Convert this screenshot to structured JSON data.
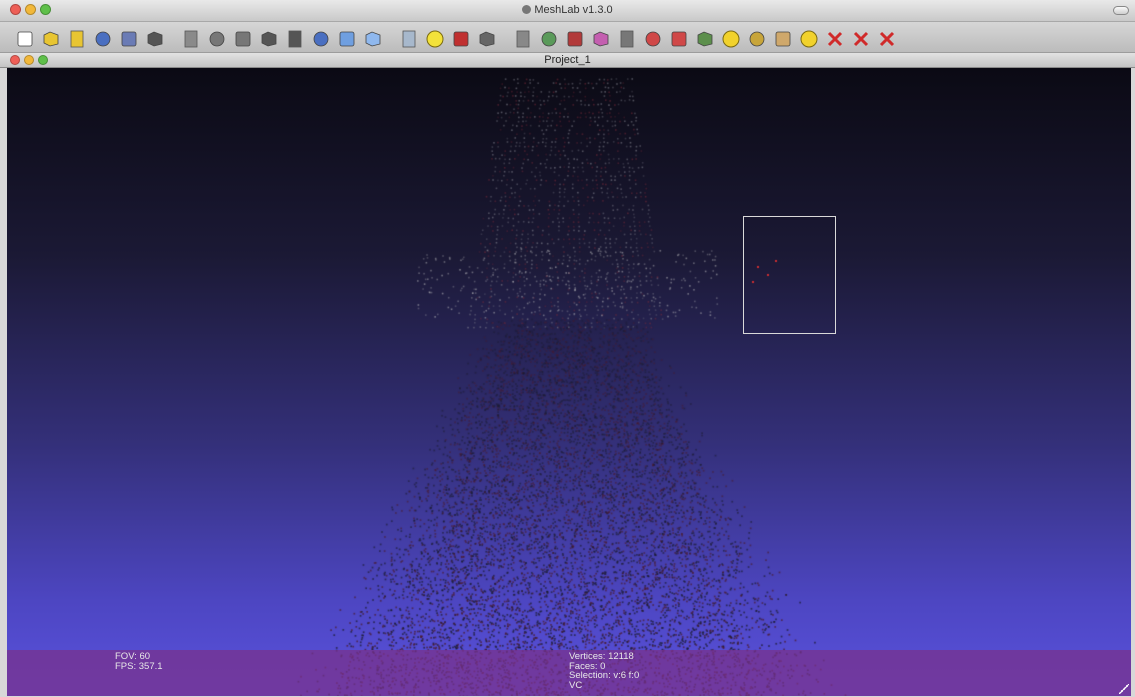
{
  "window": {
    "title": "MeshLab v1.3.0",
    "traffic_lights": [
      "#ee5f57",
      "#f2b83a",
      "#5fc04a"
    ]
  },
  "toolbar": {
    "buttons": [
      {
        "name": "new-document-icon",
        "color": "#ffffff"
      },
      {
        "name": "open-folder-icon",
        "color": "#e8c532"
      },
      {
        "name": "import-mesh-icon",
        "color": "#e8c532"
      },
      {
        "name": "reload-icon",
        "color": "#4a6fc1"
      },
      {
        "name": "save-icon",
        "color": "#6a7bb5"
      },
      {
        "name": "snapshot-icon",
        "color": "#555555"
      },
      {
        "name": "layers-icon",
        "color": "#8a8a8a"
      },
      {
        "name": "bounding-box-icon",
        "color": "#777777"
      },
      {
        "name": "points-render-icon",
        "color": "#777777"
      },
      {
        "name": "wireframe-icon",
        "color": "#555555"
      },
      {
        "name": "hidden-lines-icon",
        "color": "#555555"
      },
      {
        "name": "flat-lines-icon",
        "color": "#4a6fc1"
      },
      {
        "name": "flat-shading-icon",
        "color": "#6f9fe0"
      },
      {
        "name": "smooth-shading-icon",
        "color": "#8fb8ee"
      },
      {
        "name": "texture-icon",
        "color": "#a7b8cc"
      },
      {
        "name": "light-bulb-icon",
        "color": "#f3e23a"
      },
      {
        "name": "double-side-lighting-icon",
        "color": "#c03030"
      },
      {
        "name": "back-face-icon",
        "color": "#666666"
      },
      {
        "name": "select-icon",
        "color": "#888888"
      },
      {
        "name": "manipulator-icon",
        "color": "#5a9a5a"
      },
      {
        "name": "paint-icon",
        "color": "#b23a3a"
      },
      {
        "name": "z-painting-icon",
        "color": "#c45fb0"
      },
      {
        "name": "align-icon",
        "color": "#777777"
      },
      {
        "name": "select-faces-icon",
        "color": "#d04848"
      },
      {
        "name": "select-vertices-icon",
        "color": "#d04848"
      },
      {
        "name": "select-connected-icon",
        "color": "#5c8f4c"
      },
      {
        "name": "annotation-icon",
        "color": "#f1d22c"
      },
      {
        "name": "measure-icon",
        "color": "#c8a53a"
      },
      {
        "name": "brush-icon",
        "color": "#cfa86b"
      },
      {
        "name": "info-icon",
        "color": "#f1d22c"
      },
      {
        "name": "delete-faces-icon",
        "color": "#d02a2a"
      },
      {
        "name": "delete-vertices-icon",
        "color": "#d02a2a"
      },
      {
        "name": "delete-all-icon",
        "color": "#d02a2a"
      }
    ]
  },
  "project": {
    "title": "Project_1"
  },
  "viewport": {
    "background_top": "#0b0a14",
    "background_bottom": "#5a52de"
  },
  "status": {
    "fov": "FOV: 60",
    "fps": "FPS:  357.1",
    "vertices": "Vertices: 12118",
    "faces": "Faces: 0",
    "selection": "Selection: v:6 f:0",
    "mode": "VC"
  }
}
